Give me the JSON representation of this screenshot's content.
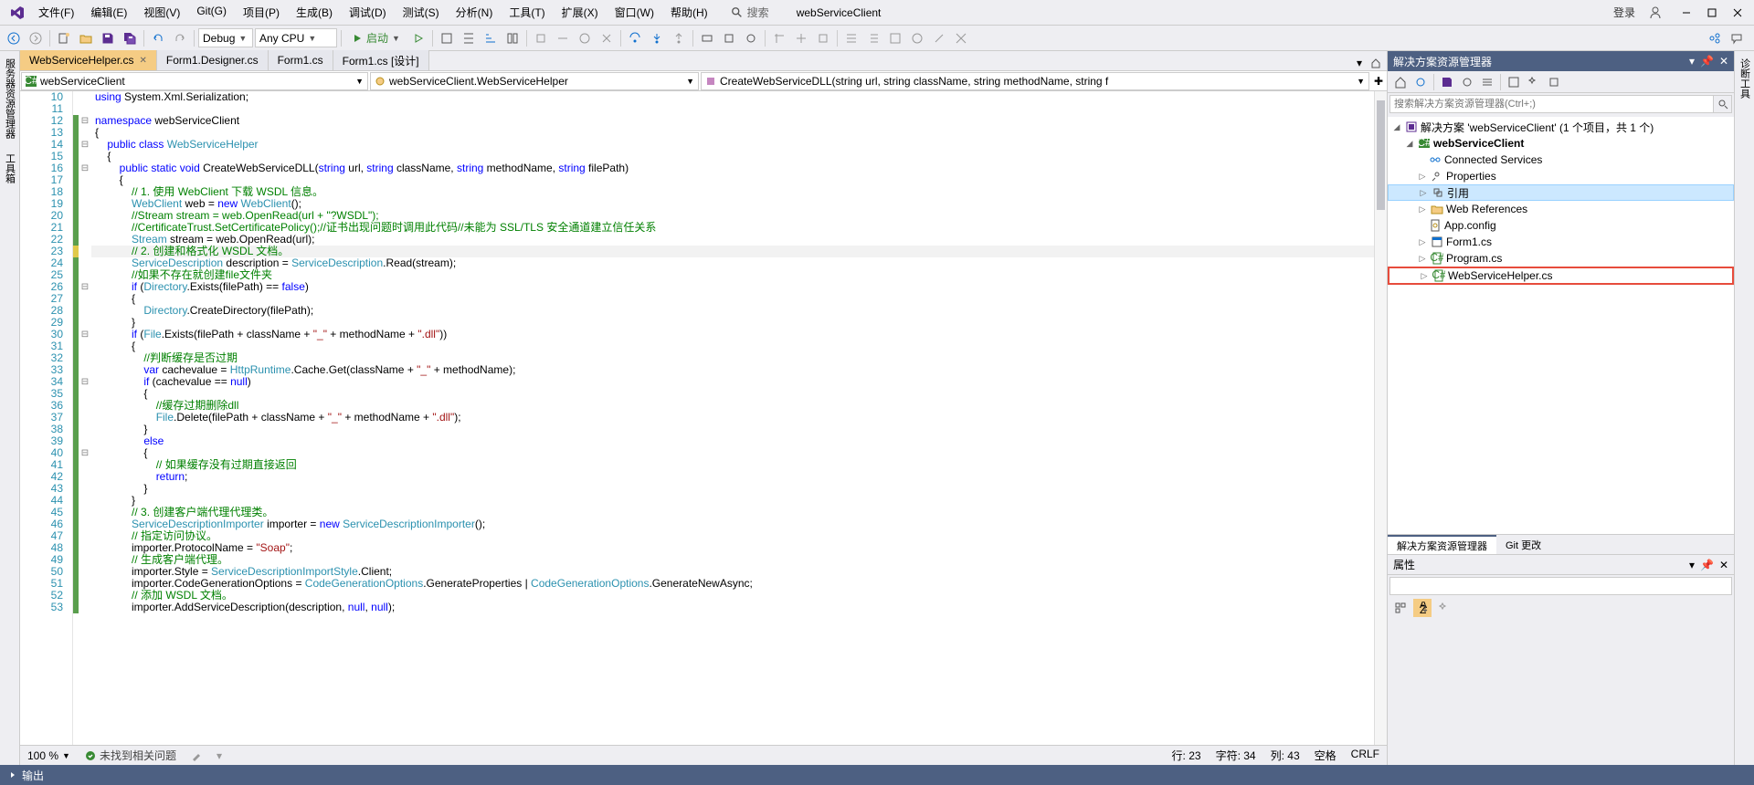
{
  "menu": {
    "items": [
      "文件(F)",
      "编辑(E)",
      "视图(V)",
      "Git(G)",
      "项目(P)",
      "生成(B)",
      "调试(D)",
      "测试(S)",
      "分析(N)",
      "工具(T)",
      "扩展(X)",
      "窗口(W)",
      "帮助(H)"
    ],
    "search": "搜索",
    "title": "webServiceClient",
    "login": "登录"
  },
  "toolbar": {
    "config": "Debug",
    "platform": "Any CPU",
    "start": "启动"
  },
  "tabs": [
    {
      "label": "WebServiceHelper.cs",
      "active": true
    },
    {
      "label": "Form1.Designer.cs",
      "active": false
    },
    {
      "label": "Form1.cs",
      "active": false
    },
    {
      "label": "Form1.cs [设计]",
      "active": false
    }
  ],
  "breadcrumb": {
    "c1": "webServiceClient",
    "c2": "webServiceClient.WebServiceHelper",
    "c3": "CreateWebServiceDLL(string url, string className, string methodName, string f"
  },
  "code": {
    "start": 10,
    "lines": [
      {
        "n": 10,
        "t": "",
        "h": "<span class='kw'>using</span> System.Xml.Serialization;"
      },
      {
        "n": 11,
        "t": "",
        "h": ""
      },
      {
        "n": 12,
        "t": "g",
        "f": "⊟",
        "h": "<span class='kw'>namespace</span> webServiceClient"
      },
      {
        "n": 13,
        "t": "g",
        "h": "{"
      },
      {
        "n": 14,
        "t": "g",
        "f": "⊟",
        "h": "    <span class='kw'>public</span> <span class='kw'>class</span> <span class='type'>WebServiceHelper</span>"
      },
      {
        "n": 15,
        "t": "g",
        "h": "    {"
      },
      {
        "n": 16,
        "t": "g",
        "f": "⊟",
        "h": "        <span class='kw'>public</span> <span class='kw'>static</span> <span class='kw'>void</span> CreateWebServiceDLL(<span class='kw'>string</span> url, <span class='kw'>string</span> className, <span class='kw'>string</span> methodName, <span class='kw'>string</span> filePath)"
      },
      {
        "n": 17,
        "t": "g",
        "h": "        {"
      },
      {
        "n": 18,
        "t": "g",
        "h": "            <span class='com'>// 1. 使用 WebClient 下载 WSDL 信息。</span>"
      },
      {
        "n": 19,
        "t": "g",
        "h": "            <span class='type'>WebClient</span> web = <span class='kw'>new</span> <span class='type'>WebClient</span>();"
      },
      {
        "n": 20,
        "t": "g",
        "h": "            <span class='com'>//Stream stream = web.OpenRead(url + \"?WSDL\");</span>"
      },
      {
        "n": 21,
        "t": "g",
        "h": "            <span class='com'>//CertificateTrust.SetCertificatePolicy();//证书出现问题时调用此代码//未能为 SSL/TLS 安全通道建立信任关系</span>"
      },
      {
        "n": 22,
        "t": "g",
        "h": "            <span class='type'>Stream</span> stream = web.OpenRead(url);"
      },
      {
        "n": 23,
        "t": "y",
        "hl": true,
        "h": "            <span class='com'>// 2. 创建和格式化 WSDL 文档。</span>"
      },
      {
        "n": 24,
        "t": "g",
        "h": "            <span class='type'>ServiceDescription</span> description = <span class='type'>ServiceDescription</span>.Read(stream);"
      },
      {
        "n": 25,
        "t": "g",
        "h": "            <span class='com'>//如果不存在就创建file文件夹</span>"
      },
      {
        "n": 26,
        "t": "g",
        "f": "⊟",
        "h": "            <span class='kw'>if</span> (<span class='type'>Directory</span>.Exists(filePath) == <span class='kw'>false</span>)"
      },
      {
        "n": 27,
        "t": "g",
        "h": "            {"
      },
      {
        "n": 28,
        "t": "g",
        "h": "                <span class='type'>Directory</span>.CreateDirectory(filePath);"
      },
      {
        "n": 29,
        "t": "g",
        "h": "            }"
      },
      {
        "n": 30,
        "t": "g",
        "f": "⊟",
        "h": "            <span class='kw'>if</span> (<span class='type'>File</span>.Exists(filePath + className + <span class='str'>\"_\"</span> + methodName + <span class='str'>\".dll\"</span>))"
      },
      {
        "n": 31,
        "t": "g",
        "h": "            {"
      },
      {
        "n": 32,
        "t": "g",
        "h": "                <span class='com'>//判断缓存是否过期</span>"
      },
      {
        "n": 33,
        "t": "g",
        "h": "                <span class='kw'>var</span> cachevalue = <span class='type'>HttpRuntime</span>.Cache.Get(className + <span class='str'>\"_\"</span> + methodName);"
      },
      {
        "n": 34,
        "t": "g",
        "f": "⊟",
        "h": "                <span class='kw'>if</span> (cachevalue == <span class='kw'>null</span>)"
      },
      {
        "n": 35,
        "t": "g",
        "h": "                {"
      },
      {
        "n": 36,
        "t": "g",
        "h": "                    <span class='com'>//缓存过期删除dll</span>"
      },
      {
        "n": 37,
        "t": "g",
        "h": "                    <span class='type'>File</span>.Delete(filePath + className + <span class='str'>\"_\"</span> + methodName + <span class='str'>\".dll\"</span>);"
      },
      {
        "n": 38,
        "t": "g",
        "h": "                }"
      },
      {
        "n": 39,
        "t": "g",
        "h": "                <span class='kw'>else</span>"
      },
      {
        "n": 40,
        "t": "g",
        "f": "⊟",
        "h": "                {"
      },
      {
        "n": 41,
        "t": "g",
        "h": "                    <span class='com'>// 如果缓存没有过期直接返回</span>"
      },
      {
        "n": 42,
        "t": "g",
        "h": "                    <span class='kw'>return</span>;"
      },
      {
        "n": 43,
        "t": "g",
        "h": "                }"
      },
      {
        "n": 44,
        "t": "g",
        "h": "            }"
      },
      {
        "n": 45,
        "t": "g",
        "h": "            <span class='com'>// 3. 创建客户端代理代理类。</span>"
      },
      {
        "n": 46,
        "t": "g",
        "h": "            <span class='type'>ServiceDescriptionImporter</span> importer = <span class='kw'>new</span> <span class='type'>ServiceDescriptionImporter</span>();"
      },
      {
        "n": 47,
        "t": "g",
        "h": "            <span class='com'>// 指定访问协议。</span>"
      },
      {
        "n": 48,
        "t": "g",
        "h": "            importer.ProtocolName = <span class='str'>\"Soap\"</span>;"
      },
      {
        "n": 49,
        "t": "g",
        "h": "            <span class='com'>// 生成客户端代理。</span>"
      },
      {
        "n": 50,
        "t": "g",
        "h": "            importer.Style = <span class='type'>ServiceDescriptionImportStyle</span>.Client;"
      },
      {
        "n": 51,
        "t": "g",
        "h": "            importer.CodeGenerationOptions = <span class='type'>CodeGenerationOptions</span>.GenerateProperties | <span class='type'>CodeGenerationOptions</span>.GenerateNewAsync;"
      },
      {
        "n": 52,
        "t": "g",
        "h": "            <span class='com'>// 添加 WSDL 文档。</span>"
      },
      {
        "n": 53,
        "t": "g",
        "h": "            importer.AddServiceDescription(description, <span class='kw'>null</span>, <span class='kw'>null</span>);"
      }
    ]
  },
  "edstatus": {
    "zoom": "100 %",
    "issues": "未找到相关问题",
    "line": "行: 23",
    "char": "字符: 34",
    "col": "列: 43",
    "spaces": "空格",
    "crlf": "CRLF"
  },
  "solution": {
    "title": "解决方案资源管理器",
    "search_ph": "搜索解决方案资源管理器(Ctrl+;)",
    "root": "解决方案 'webServiceClient' (1 个项目，共 1 个)",
    "project": "webServiceClient",
    "nodes": {
      "connected": "Connected Services",
      "properties": "Properties",
      "refs": "引用",
      "webrefs": "Web References",
      "appconfig": "App.config",
      "form1": "Form1.cs",
      "program": "Program.cs",
      "wshelper": "WebServiceHelper.cs"
    },
    "tab1": "解决方案资源管理器",
    "tab2": "Git 更改"
  },
  "props": {
    "title": "属性"
  },
  "rail": {
    "left1": "服务器资源管理器",
    "left2": "工具箱",
    "right1": "诊断工具"
  },
  "statusbar": {
    "output": "输出"
  }
}
